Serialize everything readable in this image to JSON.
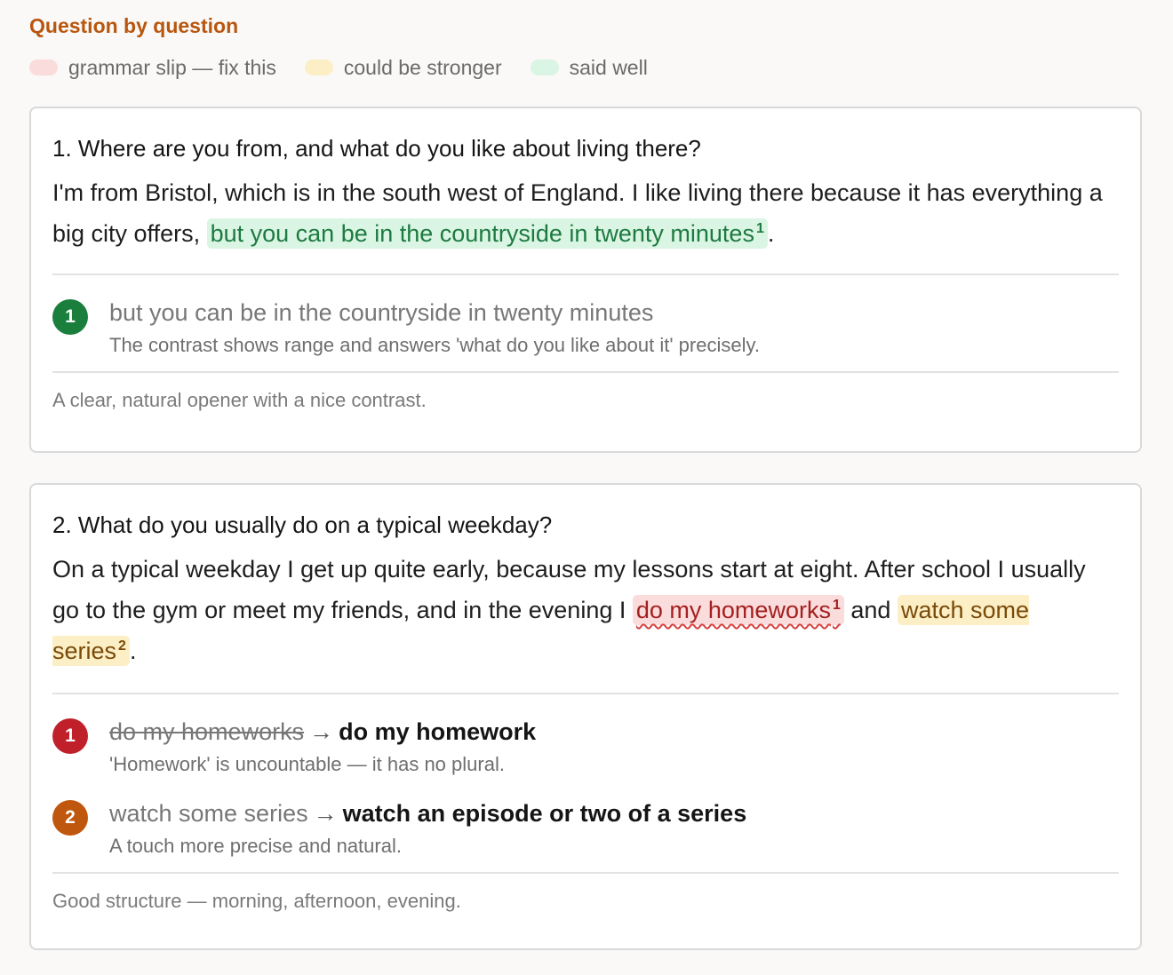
{
  "section_title": "Question by question",
  "legend": [
    {
      "label": "grammar slip — fix this",
      "color": "#fbdcdc"
    },
    {
      "label": "could be stronger",
      "color": "#fcefc6"
    },
    {
      "label": "said well",
      "color": "#daf5e3"
    }
  ],
  "questions": [
    {
      "title": "1. Where are you from, and what do you like about living there?",
      "answer_pre": "I'm from Bristol, which is in the south west of England. I like living there because it has everything a big city offers,",
      "hl1_text": "but you can be in the countryside in twenty minutes",
      "hl1_num": "1",
      "answer_post": ".",
      "notes": [
        {
          "num": "1",
          "phrase": "but you can be in the countryside in twenty minutes",
          "explanation": "The contrast shows range and answers 'what do you like about it' precisely."
        }
      ],
      "summary": "A clear, natural opener with a nice contrast."
    },
    {
      "title": "2. What do you usually do on a typical weekday?",
      "answer_pre": "On a typical weekday I get up quite early, because my lessons start at eight. After school I usually go to the gym or meet my friends, and in the evening I",
      "hl1_text": "do my homeworks",
      "hl1_num": "1",
      "answer_mid": "and",
      "hl2_text": "watch some series",
      "hl2_num": "2",
      "answer_post": ".",
      "notes": [
        {
          "num": "1",
          "original": "do my homeworks",
          "arrow": "→",
          "fix": "do my homework",
          "explanation": "'Homework' is uncountable — it has no plural."
        },
        {
          "num": "2",
          "original": "watch some series",
          "arrow": "→",
          "fix": "watch an episode or two of a series",
          "explanation": "A touch more precise and natural."
        }
      ],
      "summary": "Good structure — morning, afternoon, evening."
    }
  ]
}
